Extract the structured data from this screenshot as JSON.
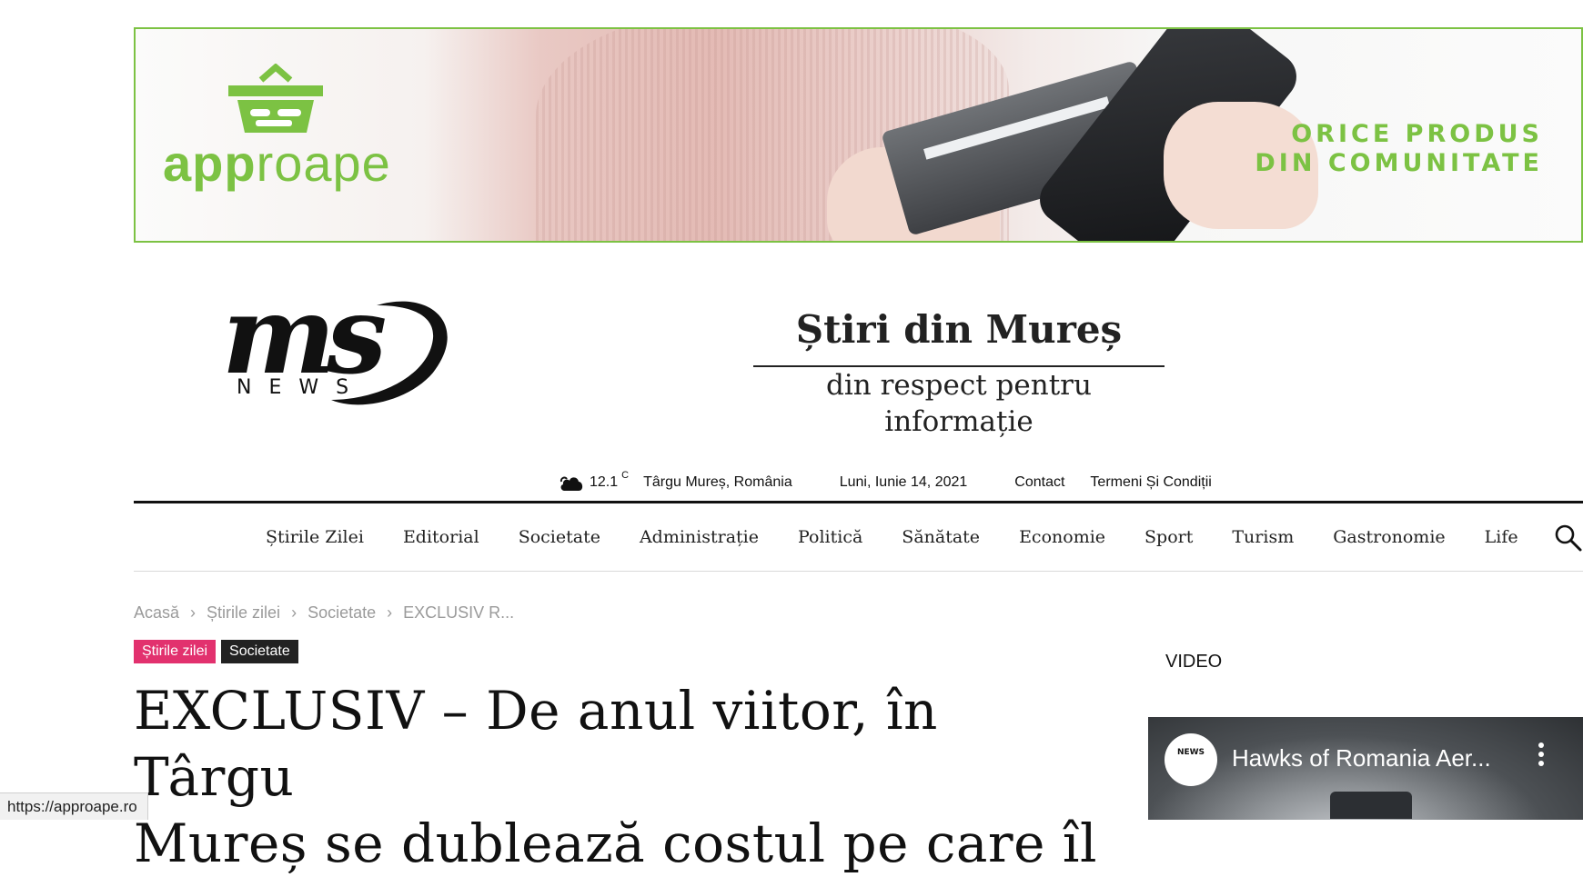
{
  "ad": {
    "brand_bold": "app",
    "brand_rest": "roape",
    "tagline_line1": "ORICE PRODUS",
    "tagline_line2": "DIN COMUNITATE",
    "accent": "#7cc243"
  },
  "logo": {
    "mark": "ms",
    "word": "NEWS"
  },
  "header": {
    "title": "Știri din Mureș",
    "subtitle": "din respect pentru informație"
  },
  "topbar": {
    "weather_icon": "cloud-icon",
    "temperature": "12.1",
    "unit": "C",
    "location": "Târgu Mureș, România",
    "date": "Luni, Iunie 14, 2021",
    "links": [
      "Contact",
      "Termeni Și Condiții"
    ]
  },
  "nav": {
    "items": [
      "Știrile Zilei",
      "Editorial",
      "Societate",
      "Administrație",
      "Politică",
      "Sănătate",
      "Economie",
      "Sport",
      "Turism",
      "Gastronomie",
      "Life"
    ],
    "search_icon": "search-icon"
  },
  "breadcrumb": {
    "items": [
      "Acasă",
      "Știrile zilei",
      "Societate",
      "EXCLUSIV R..."
    ],
    "separator": "›"
  },
  "tags": [
    {
      "label": "Știrile zilei",
      "color": "#e2316e"
    },
    {
      "label": "Societate",
      "color": "#222222"
    }
  ],
  "article": {
    "headline_line1": "EXCLUSIV – De anul viitor, în Târgu",
    "headline_line2": "Mureș se dublează costul pe care îl"
  },
  "sidebar": {
    "video_label": "VIDEO",
    "video": {
      "title": "Hawks of Romania Aer...",
      "channel_badge": "NEWS"
    }
  },
  "status_bar": {
    "url": "https://approape.ro"
  }
}
